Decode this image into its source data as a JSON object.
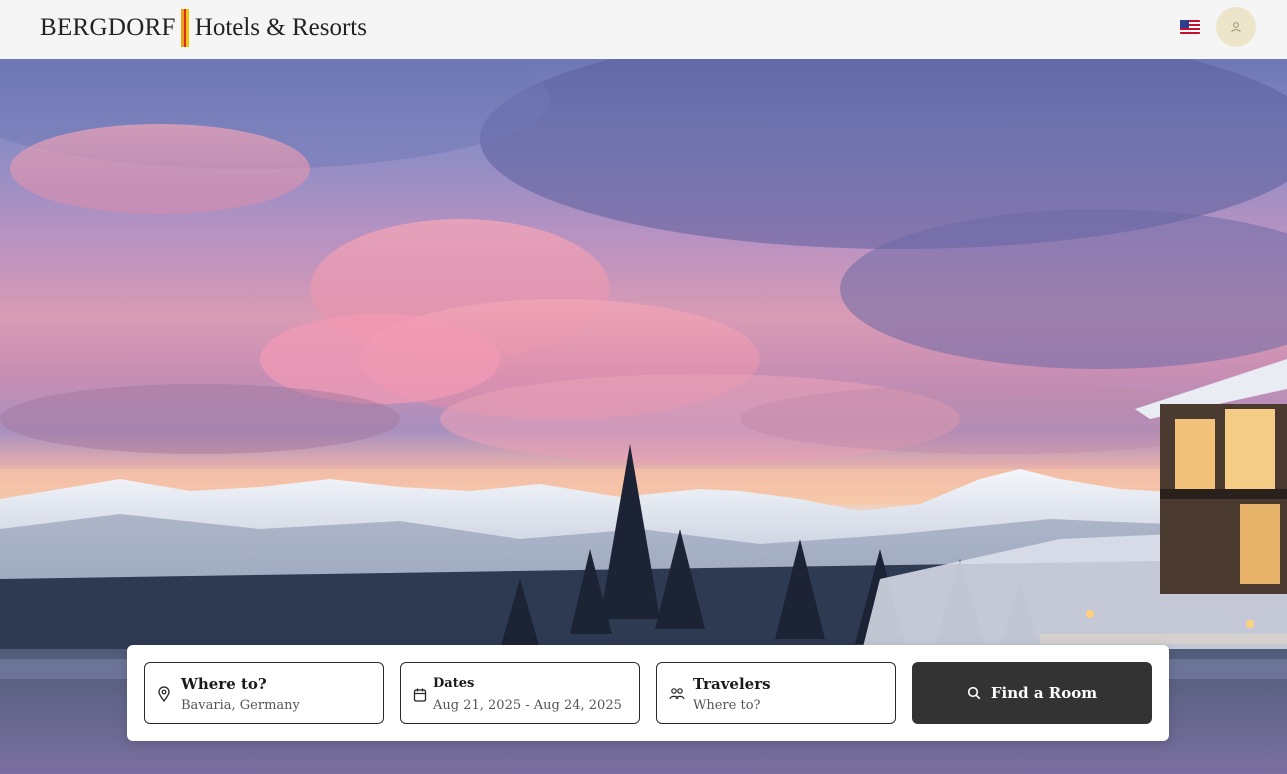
{
  "header": {
    "brand_primary": "BERGDORF",
    "brand_secondary": "Hotels & Resorts",
    "brand_colors": [
      "#e8a317",
      "#d62d20",
      "#f1c40f"
    ],
    "language_icon": "us-flag-icon",
    "account_icon": "user-icon"
  },
  "search": {
    "destination": {
      "label": "Where to?",
      "value": "Bavaria, Germany",
      "icon": "map-pin-icon"
    },
    "dates": {
      "label": "Dates",
      "value": "Aug 21, 2025 - Aug 24, 2025",
      "icon": "calendar-icon"
    },
    "travelers": {
      "label": "Travelers",
      "placeholder": "Where to?",
      "icon": "users-icon"
    },
    "submit": {
      "label": "Find a Room",
      "icon": "search-icon"
    }
  },
  "colors": {
    "header_bg": "#f5f5f5",
    "button_bg": "#333333",
    "avatar_bg": "#ece5c9"
  }
}
